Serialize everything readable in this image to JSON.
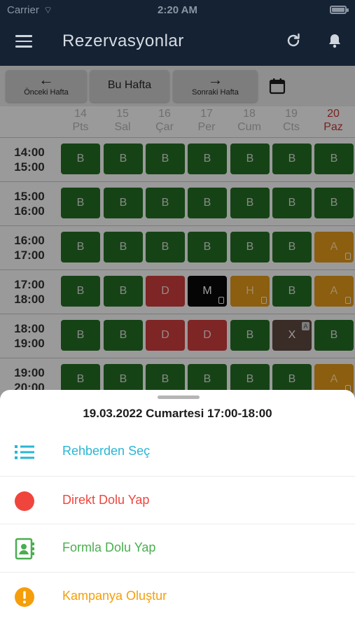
{
  "status": {
    "carrier": "Carrier",
    "time": "2:20 AM"
  },
  "appbar": {
    "title": "Rezervasyonlar"
  },
  "weeknav": {
    "prev_label": "Önceki Hafta",
    "current_label": "Bu Hafta",
    "next_label": "Sonraki Hafta"
  },
  "days": [
    {
      "num": "14",
      "name": "Pts"
    },
    {
      "num": "15",
      "name": "Sal"
    },
    {
      "num": "16",
      "name": "Çar"
    },
    {
      "num": "17",
      "name": "Per"
    },
    {
      "num": "18",
      "name": "Cum"
    },
    {
      "num": "19",
      "name": "Cts"
    },
    {
      "num": "20",
      "name": "Paz"
    }
  ],
  "rows": [
    {
      "start": "14:00",
      "end": "15:00",
      "cells": [
        "B",
        "B",
        "B",
        "B",
        "B",
        "B",
        "B"
      ]
    },
    {
      "start": "15:00",
      "end": "16:00",
      "cells": [
        "B",
        "B",
        "B",
        "B",
        "B",
        "B",
        "B"
      ]
    },
    {
      "start": "16:00",
      "end": "17:00",
      "cells": [
        "B",
        "B",
        "B",
        "B",
        "B",
        "B",
        "A"
      ]
    },
    {
      "start": "17:00",
      "end": "18:00",
      "cells": [
        "B",
        "B",
        "D",
        "M",
        "H",
        "B",
        "A"
      ]
    },
    {
      "start": "18:00",
      "end": "19:00",
      "cells": [
        "B",
        "B",
        "D",
        "D",
        "B",
        "X",
        "B"
      ]
    },
    {
      "start": "19:00",
      "end": "20:00",
      "cells": [
        "B",
        "B",
        "B",
        "B",
        "B",
        "B",
        "A"
      ]
    }
  ],
  "sheet": {
    "title": "19.03.2022 Cumartesi 17:00-18:00",
    "options": [
      {
        "label": "Rehberden Seç",
        "color": "#29b6d5",
        "icon": "list-icon"
      },
      {
        "label": "Direkt Dolu Yap",
        "color": "#f0453c",
        "icon": "red-circle-icon"
      },
      {
        "label": "Formla Dolu Yap",
        "color": "#4aae4f",
        "icon": "contact-card-icon"
      },
      {
        "label": "Kampanya Oluştur",
        "color": "#f59e0b",
        "icon": "exclamation-circle-icon"
      }
    ]
  },
  "colors": {
    "appbar_bg": "#142234",
    "free_green": "#164316",
    "booked_red": "#7e2525",
    "pending_orange": "#8b5e10",
    "sunday_red": "#7a2121"
  }
}
